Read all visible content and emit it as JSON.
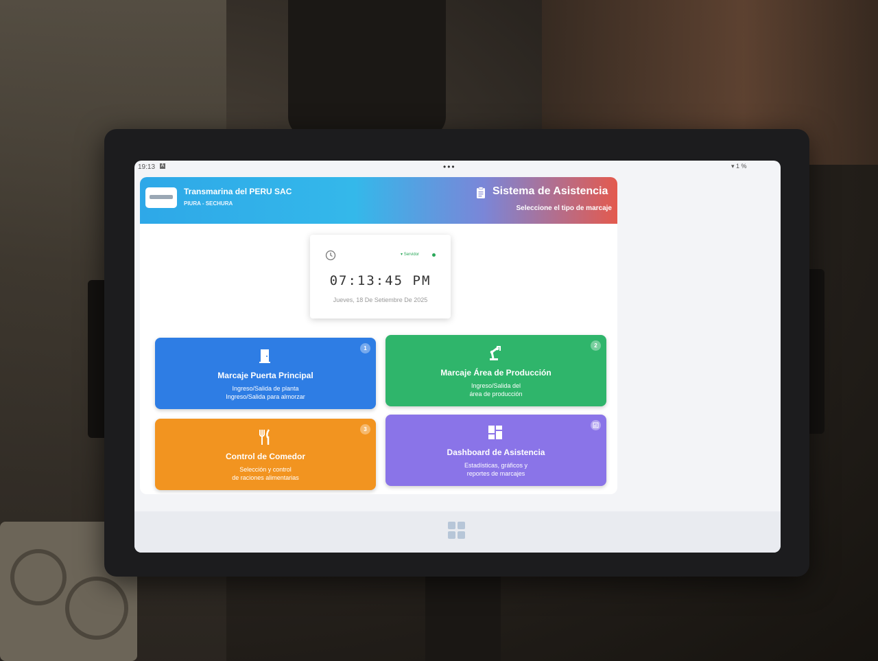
{
  "status_bar": {
    "time": "19:13",
    "indicator": "A",
    "dots": "•••",
    "battery": "1 %"
  },
  "header": {
    "company": "Transmarina del PERU SAC",
    "location": "PIURA - SECHURA",
    "title": "Sistema de Asistencia",
    "subtitle": "Seleccione el tipo de marcaje",
    "icon": "clipboard-icon"
  },
  "clock": {
    "server_label": "Servidor",
    "time": "07:13:45 PM",
    "date": "Jueves, 18 De Setiembre De 2025",
    "icon": "clock-icon"
  },
  "tiles": [
    {
      "badge": "1",
      "title": "Marcaje Puerta Principal",
      "lines": [
        "Ingreso/Salida de planta",
        "Ingreso/Salida para almorzar"
      ],
      "icon": "door-icon",
      "color": "#2e7de4"
    },
    {
      "badge": "2",
      "title": "Marcaje Área de Producción",
      "lines": [
        "Ingreso/Salida del",
        "área de producción"
      ],
      "icon": "robot-arm-icon",
      "color": "#2fb56b"
    },
    {
      "badge": "3",
      "title": "Control de Comedor",
      "lines": [
        "Selección y control",
        "de raciones alimentarias"
      ],
      "icon": "utensils-icon",
      "color": "#f29420"
    },
    {
      "badge": "",
      "title": "Dashboard de Asistencia",
      "lines": [
        "Estadísticas, gráficos y",
        "reportes de marcajes"
      ],
      "icon": "dashboard-icon",
      "color": "#8a74e8"
    }
  ]
}
